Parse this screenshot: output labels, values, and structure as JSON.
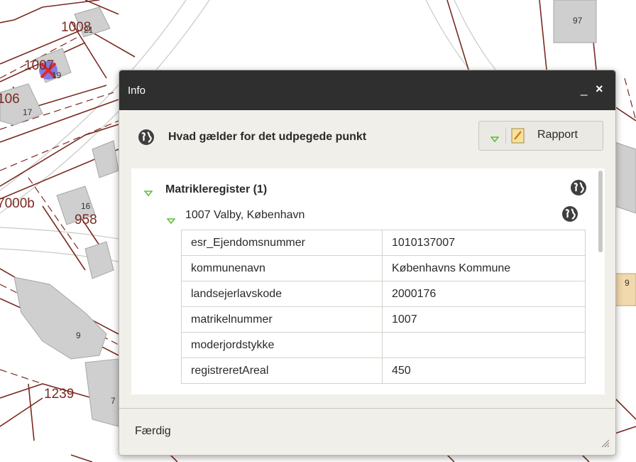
{
  "map": {
    "parcel_labels": [
      "1008",
      "1007",
      "106",
      "7000b",
      "958",
      "1239"
    ],
    "house_numbers": [
      "21",
      "19",
      "17",
      "16",
      "9",
      "7",
      "97",
      "9"
    ]
  },
  "dialog": {
    "title": "Info",
    "minimize": "_",
    "close": "×",
    "header": "Hvad gælder for det udpegede punkt",
    "report_label": "Rapport",
    "layer": {
      "title": "Matrikleregister (1)",
      "item_title": "1007 Valby, København",
      "rows": [
        {
          "key": "esr_Ejendomsnummer",
          "value": "1010137007"
        },
        {
          "key": "kommunenavn",
          "value": "Københavns Kommune"
        },
        {
          "key": "landsejerlavskode",
          "value": "2000176"
        },
        {
          "key": "matrikelnummer",
          "value": "1007"
        },
        {
          "key": "moderjordstykke",
          "value": ""
        },
        {
          "key": "registreretAreal",
          "value": "450"
        }
      ]
    },
    "status": "Færdig"
  },
  "colors": {
    "titlebar": "#2f2f2f",
    "dialog_bg": "#f1efe9",
    "parcel_line": "#7a2a22",
    "building": "#cfcfcf",
    "marker": "#e0282a"
  }
}
